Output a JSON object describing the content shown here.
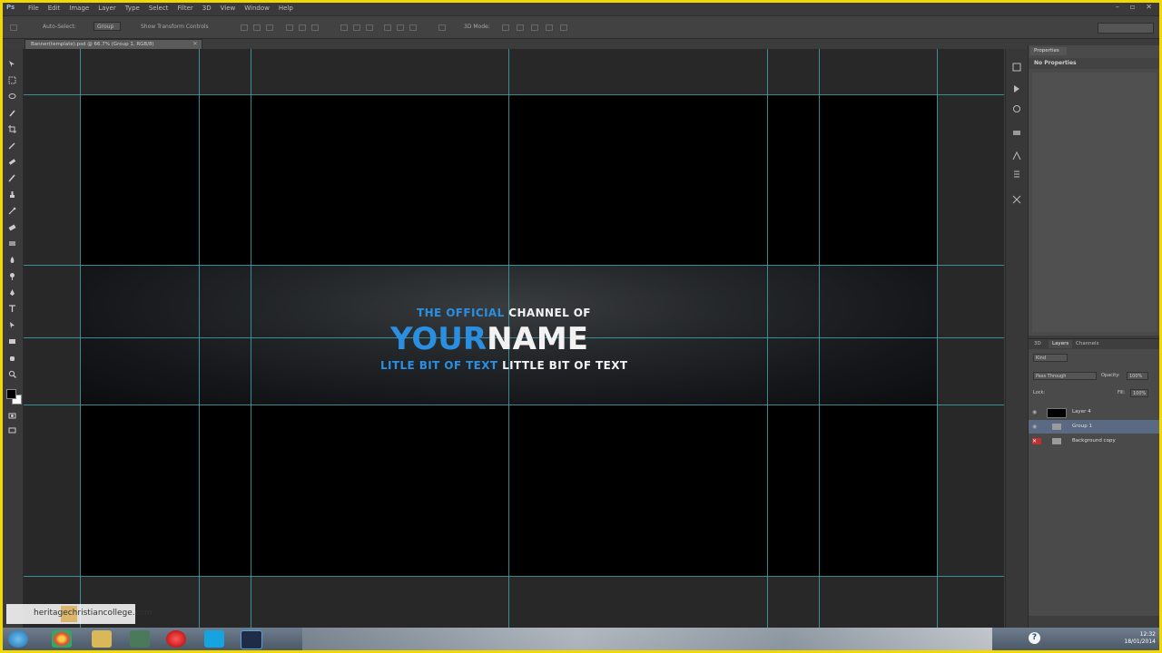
{
  "app": {
    "logo": "Ps",
    "menus": [
      "File",
      "Edit",
      "Image",
      "Layer",
      "Type",
      "Select",
      "Filter",
      "3D",
      "View",
      "Window",
      "Help"
    ],
    "window_controls": [
      "–",
      "▫",
      "✕"
    ]
  },
  "options": {
    "auto_select_label": "Auto-Select:",
    "auto_select_value": "Group",
    "transform_label": "Show Transform Controls",
    "mode_label": "3D Mode:"
  },
  "document": {
    "tab_title": "Banner(template).psd @ 66.7% (Group 1, RGB/8)",
    "close": "×"
  },
  "banner": {
    "line1_blue": "THE OFFICIAL",
    "line1_white": "CHANNEL OF",
    "line2_blue": "YOUR",
    "line2_white": "NAME",
    "line3_blue": "LITLE BIT OF TEXT",
    "line3_white": "LITTLE BIT OF TEXT",
    "colors": {
      "blue": "#2a8fe0",
      "white": "#f2f2f2",
      "guide": "#3fa0a8"
    }
  },
  "properties": {
    "tab": "Properties",
    "header": "No Properties"
  },
  "layers": {
    "tabs": [
      "3D",
      "Layers",
      "Channels"
    ],
    "kind": "Kind",
    "blend": "Pass Through",
    "opacity_label": "Opacity:",
    "opacity": "100%",
    "lock_label": "Lock:",
    "fill_label": "Fill:",
    "fill": "100%",
    "items": [
      {
        "name": "Layer 4",
        "selected": false
      },
      {
        "name": "Group 1",
        "selected": true
      },
      {
        "name": "Background copy",
        "selected": false
      }
    ]
  },
  "watermark": {
    "text": "heritagechristiancollege.com"
  },
  "taskbar": {
    "time": "12:32",
    "date": "18/01/2014",
    "help": "?"
  }
}
